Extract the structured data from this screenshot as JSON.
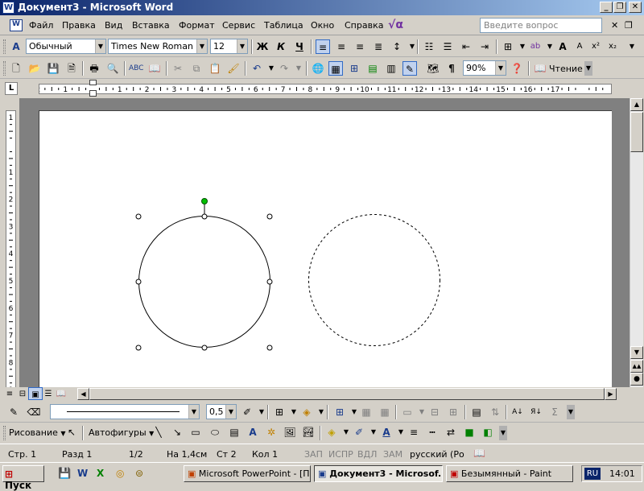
{
  "window": {
    "title": "Документ3 - Microsoft Word",
    "app_icon": "W"
  },
  "menu": {
    "items": [
      "Файл",
      "Правка",
      "Вид",
      "Вставка",
      "Формат",
      "Сервис",
      "Таблица",
      "Окно",
      "Справка"
    ],
    "help_placeholder": "Введите вопрос"
  },
  "formatting": {
    "style": "Обычный",
    "font": "Times New Roman",
    "size": "12"
  },
  "standard": {
    "zoom": "90%",
    "reading_label": "Чтение"
  },
  "ruler": {
    "h_labels": [
      "2",
      "1",
      "1",
      "2",
      "3",
      "4",
      "5",
      "6",
      "7",
      "8",
      "9",
      "10",
      "11",
      "12",
      "13",
      "14",
      "15",
      "16",
      "17"
    ],
    "v_labels": [
      "1",
      "1",
      "2",
      "3",
      "4",
      "5",
      "6",
      "7",
      "8",
      "9"
    ]
  },
  "picture_toolbar": {
    "line_weight": "0,5"
  },
  "drawing": {
    "draw_label": "Рисование",
    "autoshapes_label": "Автофигуры"
  },
  "status": {
    "page": "Стр. 1",
    "section": "Разд 1",
    "pages": "1/2",
    "at": "На 1,4см",
    "line": "Ст 2",
    "col": "Кол 1",
    "rec": "ЗАП",
    "trk": "ИСПР",
    "ext": "ВДЛ",
    "ovr": "ЗАМ",
    "language": "русский (Ро"
  },
  "taskbar": {
    "start_label": "Пуск",
    "tasks": [
      "Microsoft PowerPoint - [П...",
      "Документ3 - Microsof...",
      "Безымянный - Paint"
    ],
    "lang": "RU",
    "clock": "14:01"
  },
  "colors": {
    "title_start": "#0a246a",
    "title_end": "#a6caf0",
    "handle_green": "#00c000"
  }
}
